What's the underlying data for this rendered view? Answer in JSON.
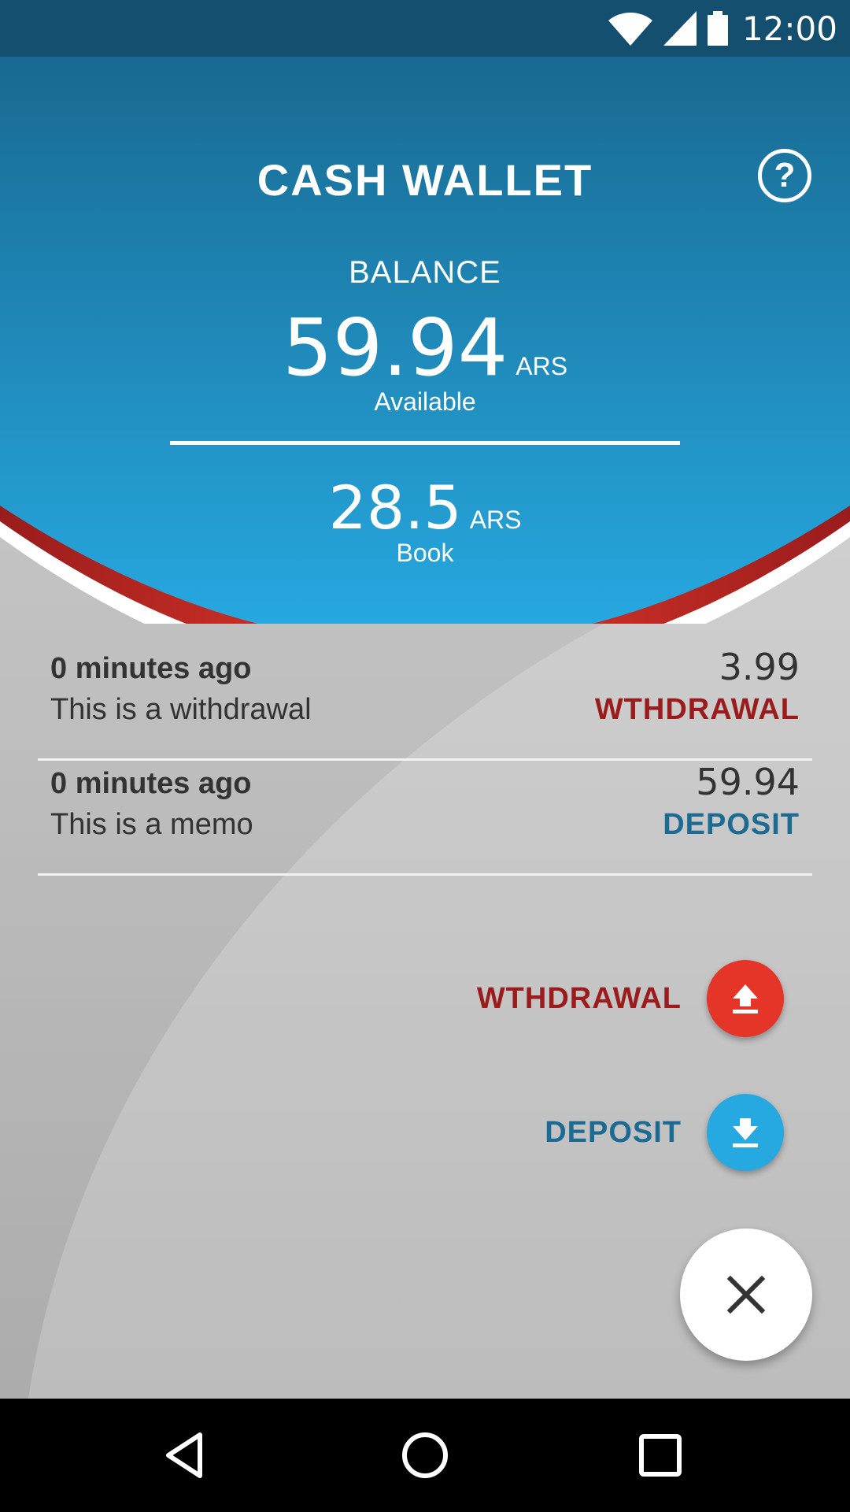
{
  "status_bar": {
    "time": "12:00",
    "icons": [
      "wifi-icon",
      "signal-icon",
      "battery-icon"
    ]
  },
  "header": {
    "title": "CASH WALLET",
    "help_icon": "help-icon",
    "help_glyph": "?",
    "balance_label": "BALANCE",
    "available_amount": "59.94",
    "available_currency": "ARS",
    "available_label": "Available",
    "book_amount": "28.5",
    "book_currency": "ARS",
    "book_label": "Book"
  },
  "transactions": [
    {
      "time": "0 minutes ago",
      "memo": "This is a withdrawal",
      "amount": "3.99",
      "type": "WTHDRAWAL"
    },
    {
      "time": "0 minutes ago",
      "memo": "This is a memo",
      "amount": "59.94",
      "type": "DEPOSIT"
    }
  ],
  "actions": {
    "withdrawal_label": "WTHDRAWAL",
    "withdrawal_icon": "upload-icon",
    "deposit_label": "DEPOSIT",
    "deposit_icon": "download-icon",
    "close_icon": "close-icon"
  },
  "nav_bar": {
    "icons": [
      "back-icon",
      "home-icon",
      "recents-icon"
    ]
  },
  "colors": {
    "status_bar": "#144f70",
    "header_top": "#1a6e96",
    "header_bottom": "#26a8e0",
    "accent_red": "#e53528",
    "withdrawal_text": "#9b1c1c",
    "deposit_text": "#1d6b93",
    "deposit_fab": "#26a9e0"
  }
}
